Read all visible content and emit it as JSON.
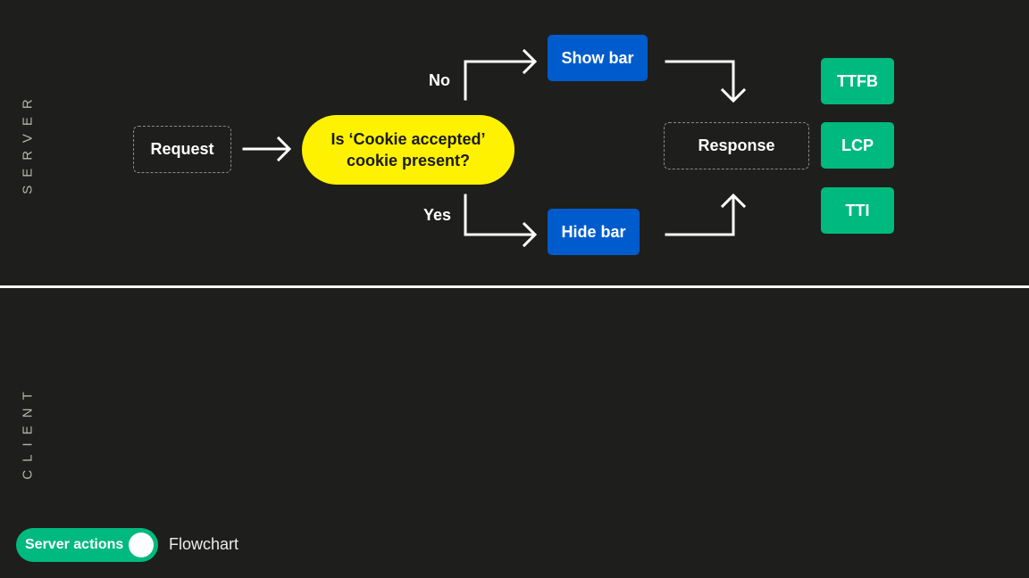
{
  "lanes": {
    "server_label": "SERVER",
    "client_label": "CLIENT"
  },
  "nodes": {
    "request": "Request",
    "decision_line1": "Is ‘Cookie accepted’",
    "decision_line2": "cookie present?",
    "show_bar": "Show bar",
    "hide_bar": "Hide bar",
    "response": "Response"
  },
  "edges": {
    "no_label": "No",
    "yes_label": "Yes"
  },
  "metrics": [
    "TTFB",
    "LCP",
    "TTI"
  ],
  "controls": {
    "toggle_label": "Server actions",
    "toggle_on": true,
    "view_label": "Flowchart"
  },
  "colors": {
    "background": "#1e1e1c",
    "decision": "#fff200",
    "action": "#005ccc",
    "metric": "#00b97e",
    "toggle": "#00b97e"
  }
}
